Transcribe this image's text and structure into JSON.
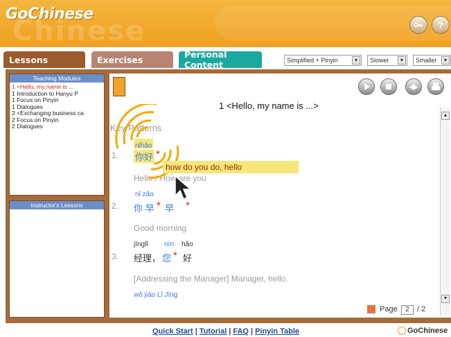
{
  "app": {
    "logo": "GoChinese",
    "watermark": "Chinese",
    "header_icons": [
      "key-icon",
      "help-icon"
    ],
    "help_label": "?"
  },
  "tabs": [
    {
      "label": "Lessons"
    },
    {
      "label": "Exercises"
    },
    {
      "label": "Personal Content"
    }
  ],
  "selects": {
    "script": "Simplified + Pinyin",
    "speed": "Slower",
    "size": "Smaller"
  },
  "sidebar": {
    "teaching_title": "Teaching Modules",
    "modules": [
      "1 <Hello, my name is ...",
      "1 Introduction to Hanyu P",
      "1 Focus on Pinyin",
      "1 Dialogues",
      "2 <Exchanging business ca",
      "2 Focus on Pinyin",
      "2 Dialogues"
    ],
    "instructor_title": "Instructor's Lessons"
  },
  "content": {
    "title": "1 <Hello, my name is ...>",
    "section": "Key Patterns",
    "items": [
      {
        "num": "1.",
        "pinyin": "nǐhǎo",
        "hanzi": "你好",
        "english": "Hello / How are you"
      },
      {
        "num": "2.",
        "pinyin": "nǐ  zǎo",
        "hanzi": "你 早",
        "hanzi_extra": "早",
        "english": "Good morning"
      },
      {
        "num": "3.",
        "pinyin_a": "jīnglǐ",
        "pinyin_b": "nín",
        "pinyin_c": "hǎo",
        "hanzi_a": "经理，",
        "hanzi_b": "您",
        "hanzi_c": "好",
        "english": "[Addressing the Manager] Manager, hello."
      }
    ],
    "next_pinyin": "wǒ  jiào  Lǐ  Jīng",
    "tooltip": "how do you do, hello",
    "pager": {
      "label": "Page",
      "current": "2",
      "total": "/ 2"
    }
  },
  "footer": {
    "links": [
      "Quick Start",
      "Tutorial",
      "FAQ",
      "Pinyin Table"
    ],
    "separator": "|",
    "brand": "GoChinese"
  },
  "colors": {
    "header": "#f0a020",
    "frame": "#a66b3a",
    "tab_lessons": "#9c5a2c",
    "tab_exercises": "#b78474",
    "tab_personal": "#1aa9a0",
    "panel_title": "#6a8ec8",
    "active_module": "#e0201a",
    "pinyin": "#3c7ae0",
    "tooltip_bg": "#f7e77a"
  }
}
